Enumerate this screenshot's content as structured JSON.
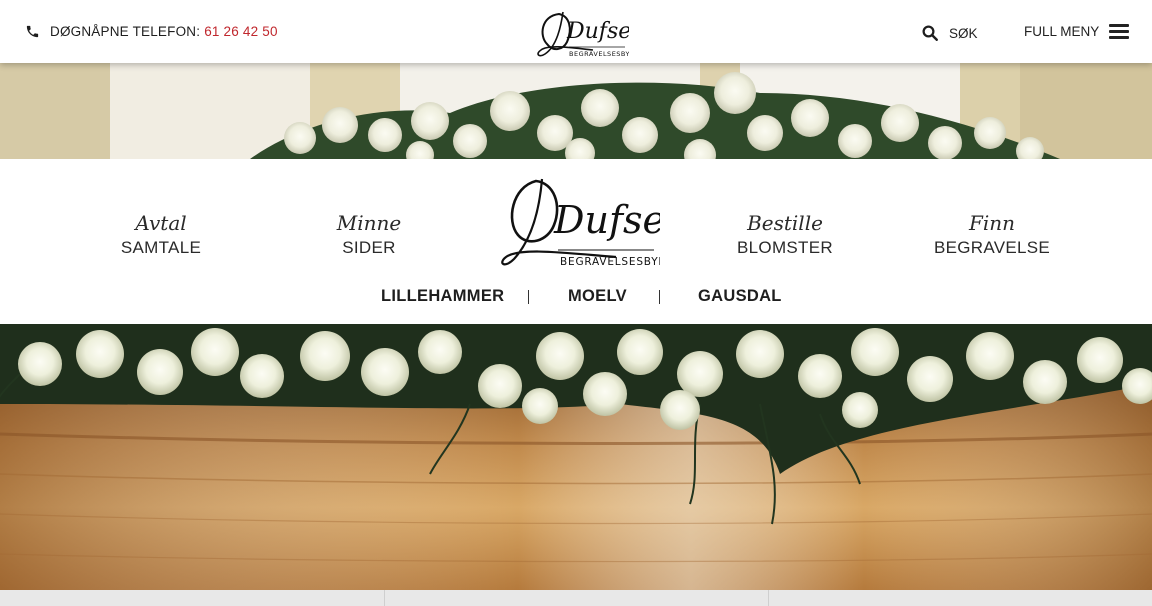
{
  "header": {
    "phone_label": "DØGNÅPNE TELEFON:",
    "phone_number": "61 26 42 50",
    "search_label": "SØK",
    "menu_label": "FULL MENY"
  },
  "logo": {
    "name": "Dufseth",
    "tagline": "BEGRAVELSESBYRÅ"
  },
  "nav": [
    {
      "script": "Avtal",
      "caps": "SAMTALE"
    },
    {
      "script": "Minne",
      "caps": "SIDER"
    },
    {
      "script": "Bestille",
      "caps": "BLOMSTER"
    },
    {
      "script": "Finn",
      "caps": "BEGRAVELSE"
    }
  ],
  "locations": [
    "LILLEHAMMER",
    "MOELV",
    "GAUSDAL"
  ],
  "colors": {
    "accent": "#c0272d",
    "text": "#222222",
    "wood": "#b07a3e"
  },
  "icons": {
    "phone": "phone-icon",
    "search": "search-icon",
    "menu": "hamburger-icon"
  }
}
